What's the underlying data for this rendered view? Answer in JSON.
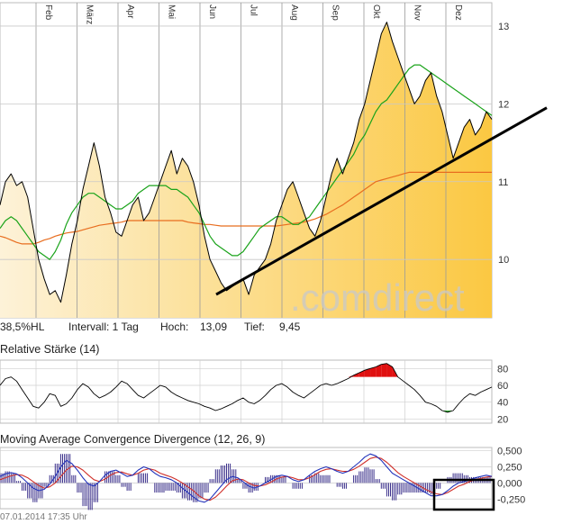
{
  "chart_data": [
    {
      "type": "area",
      "x_labels": [
        "Feb",
        "März",
        "Apr",
        "Mai",
        "Jun",
        "Jul",
        "Aug",
        "Sep",
        "Okt",
        "Nov",
        "Dez"
      ],
      "yticks": [
        10,
        11,
        12,
        13
      ],
      "ylim": [
        9.25,
        13.3
      ],
      "series": [
        {
          "values": [
            10.7,
            11.0,
            11.1,
            10.95,
            11.0,
            10.8,
            10.4,
            10.0,
            9.75,
            9.55,
            9.6,
            9.45,
            9.8,
            10.2,
            10.5,
            10.9,
            11.2,
            11.5,
            11.2,
            10.8,
            10.6,
            10.35,
            10.3,
            10.5,
            10.7,
            10.8,
            10.5,
            10.6,
            10.8,
            11.0,
            11.2,
            11.4,
            11.1,
            11.3,
            11.2,
            11.0,
            10.7,
            10.3,
            10.0,
            9.85,
            9.7,
            9.6,
            9.65,
            9.7,
            9.75,
            9.55,
            9.8,
            9.9,
            10.0,
            10.2,
            10.5,
            10.7,
            10.9,
            11.0,
            10.8,
            10.6,
            10.4,
            10.3,
            10.5,
            10.8,
            11.1,
            11.3,
            11.1,
            11.3,
            11.5,
            11.8,
            12.0,
            12.3,
            12.6,
            12.9,
            13.05,
            12.8,
            12.6,
            12.4,
            12.2,
            12.0,
            12.1,
            12.3,
            12.4,
            12.1,
            11.9,
            11.6,
            11.3,
            11.5,
            11.7,
            11.8,
            11.6,
            11.7,
            11.9,
            11.8
          ]
        },
        {
          "values": [
            10.4,
            10.5,
            10.55,
            10.5,
            10.4,
            10.3,
            10.2,
            10.1,
            10.05,
            10.0,
            10.1,
            10.25,
            10.45,
            10.6,
            10.7,
            10.8,
            10.85,
            10.85,
            10.8,
            10.75,
            10.7,
            10.65,
            10.65,
            10.7,
            10.75,
            10.85,
            10.9,
            10.95,
            10.95,
            10.95,
            10.95,
            10.9,
            10.9,
            10.85,
            10.8,
            10.7,
            10.6,
            10.45,
            10.3,
            10.2,
            10.15,
            10.1,
            10.05,
            10.05,
            10.1,
            10.2,
            10.3,
            10.4,
            10.45,
            10.5,
            10.55,
            10.55,
            10.5,
            10.45,
            10.45,
            10.5,
            10.55,
            10.65,
            10.75,
            10.85,
            10.95,
            11.05,
            11.15,
            11.25,
            11.35,
            11.5,
            11.6,
            11.75,
            11.9,
            12.0,
            12.05,
            12.15,
            12.25,
            12.35,
            12.45,
            12.5,
            12.5,
            12.45,
            12.4,
            12.35,
            12.3,
            12.25,
            12.2,
            12.15,
            12.1,
            12.05,
            12.0,
            11.95,
            11.9,
            11.85
          ]
        },
        {
          "values": [
            10.3,
            10.28,
            10.25,
            10.22,
            10.2,
            10.2,
            10.2,
            10.22,
            10.25,
            10.27,
            10.3,
            10.32,
            10.34,
            10.35,
            10.36,
            10.38,
            10.4,
            10.42,
            10.44,
            10.45,
            10.46,
            10.47,
            10.48,
            10.5,
            10.5,
            10.5,
            10.5,
            10.5,
            10.5,
            10.5,
            10.5,
            10.5,
            10.5,
            10.5,
            10.48,
            10.47,
            10.46,
            10.45,
            10.45,
            10.44,
            10.43,
            10.43,
            10.43,
            10.43,
            10.43,
            10.43,
            10.43,
            10.43,
            10.43,
            10.43,
            10.43,
            10.44,
            10.45,
            10.46,
            10.47,
            10.48,
            10.5,
            10.52,
            10.55,
            10.58,
            10.62,
            10.66,
            10.7,
            10.75,
            10.8,
            10.85,
            10.9,
            10.95,
            11.0,
            11.02,
            11.04,
            11.06,
            11.08,
            11.1,
            11.12,
            11.12,
            11.12,
            11.12,
            11.12,
            11.12,
            11.12,
            11.12,
            11.12,
            11.12,
            11.12,
            11.12,
            11.12,
            11.12,
            11.12,
            11.12
          ]
        }
      ],
      "trendline": [
        [
          9.55,
          11.95
        ]
      ],
      "watermark": ".comdirect",
      "info": {
        "hl": "38,5%HL",
        "interval": "Intervall: 1 Tag",
        "high_label": "Hoch:",
        "high_value": "13,09",
        "low_label": "Tief:",
        "low_value": "9,45"
      },
      "colors": {
        "area_top": "#fbc842",
        "area_bottom": "#fdf2d8",
        "price_line": "#000000",
        "ma_green": "#1aa31a",
        "ma_orange": "#e86d1f",
        "trendline": "#000000"
      }
    },
    {
      "type": "line",
      "title": "Relative Stärke (14)",
      "yticks": [
        20,
        40,
        60,
        80
      ],
      "ylim": [
        15,
        90
      ],
      "values": [
        60,
        68,
        70,
        65,
        55,
        45,
        35,
        33,
        40,
        50,
        48,
        35,
        38,
        45,
        55,
        62,
        58,
        50,
        45,
        48,
        52,
        58,
        65,
        62,
        55,
        48,
        45,
        50,
        55,
        60,
        58,
        52,
        48,
        45,
        42,
        40,
        38,
        35,
        33,
        30,
        32,
        35,
        38,
        42,
        45,
        40,
        38,
        42,
        48,
        55,
        60,
        62,
        58,
        52,
        48,
        45,
        50,
        55,
        60,
        62,
        60,
        62,
        65,
        68,
        72,
        75,
        78,
        80,
        82,
        85,
        86,
        82,
        70,
        65,
        60,
        55,
        48,
        40,
        38,
        35,
        30,
        28,
        30,
        38,
        45,
        50,
        48,
        52,
        55,
        58
      ],
      "overbought": 70,
      "oversold": 30,
      "colors": {
        "line": "#000000",
        "over": "#e01010",
        "under": "#22aa22",
        "ref": "#999999"
      }
    },
    {
      "type": "line",
      "title": "Moving Average Convergence Divergence (12, 26, 9)",
      "yticks": [
        "0,500",
        "0,250",
        "0,000",
        "-0,250"
      ],
      "ytick_values": [
        0.5,
        0.25,
        0.0,
        -0.25
      ],
      "ylim": [
        -0.4,
        0.55
      ],
      "series": [
        {
          "values": [
            0.1,
            0.14,
            0.16,
            0.14,
            0.08,
            0.0,
            -0.08,
            -0.12,
            -0.1,
            -0.02,
            0.1,
            0.25,
            0.35,
            0.3,
            0.2,
            0.08,
            -0.02,
            -0.05,
            0.02,
            0.12,
            0.18,
            0.2,
            0.15,
            0.1,
            0.12,
            0.2,
            0.25,
            0.22,
            0.15,
            0.1,
            0.08,
            0.05,
            0.0,
            -0.08,
            -0.15,
            -0.22,
            -0.28,
            -0.3,
            -0.25,
            -0.15,
            -0.05,
            0.05,
            0.1,
            0.08,
            0.02,
            -0.05,
            -0.08,
            -0.05,
            0.0,
            0.05,
            0.1,
            0.12,
            0.1,
            0.05,
            0.02,
            0.05,
            0.12,
            0.18,
            0.22,
            0.25,
            0.22,
            0.18,
            0.15,
            0.18,
            0.25,
            0.32,
            0.4,
            0.45,
            0.42,
            0.35,
            0.25,
            0.15,
            0.1,
            0.05,
            0.0,
            -0.05,
            -0.1,
            -0.15,
            -0.2,
            -0.2,
            -0.18,
            -0.12,
            -0.05,
            0.0,
            0.02,
            0.05,
            0.08,
            0.1,
            0.12,
            0.1
          ]
        },
        {
          "values": [
            0.05,
            0.08,
            0.11,
            0.13,
            0.12,
            0.08,
            0.02,
            -0.04,
            -0.08,
            -0.06,
            0.0,
            0.1,
            0.2,
            0.26,
            0.25,
            0.2,
            0.12,
            0.05,
            0.02,
            0.06,
            0.12,
            0.16,
            0.17,
            0.14,
            0.12,
            0.15,
            0.2,
            0.22,
            0.2,
            0.15,
            0.12,
            0.09,
            0.05,
            0.0,
            -0.06,
            -0.12,
            -0.2,
            -0.25,
            -0.27,
            -0.22,
            -0.14,
            -0.05,
            0.03,
            0.06,
            0.05,
            0.0,
            -0.04,
            -0.05,
            -0.03,
            0.01,
            0.06,
            0.09,
            0.1,
            0.08,
            0.05,
            0.05,
            0.08,
            0.13,
            0.18,
            0.21,
            0.22,
            0.2,
            0.18,
            0.18,
            0.21,
            0.26,
            0.32,
            0.38,
            0.4,
            0.38,
            0.32,
            0.24,
            0.16,
            0.1,
            0.05,
            0.0,
            -0.05,
            -0.1,
            -0.14,
            -0.17,
            -0.18,
            -0.15,
            -0.1,
            -0.05,
            -0.02,
            0.02,
            0.05,
            0.07,
            0.09,
            0.1
          ]
        }
      ],
      "colors": {
        "macd": "#2233bb",
        "signal": "#d0302a",
        "hist": "#3a2f8a",
        "box": "#000000"
      }
    }
  ],
  "timestamp": "07.01.2014 17:35 Uhr"
}
